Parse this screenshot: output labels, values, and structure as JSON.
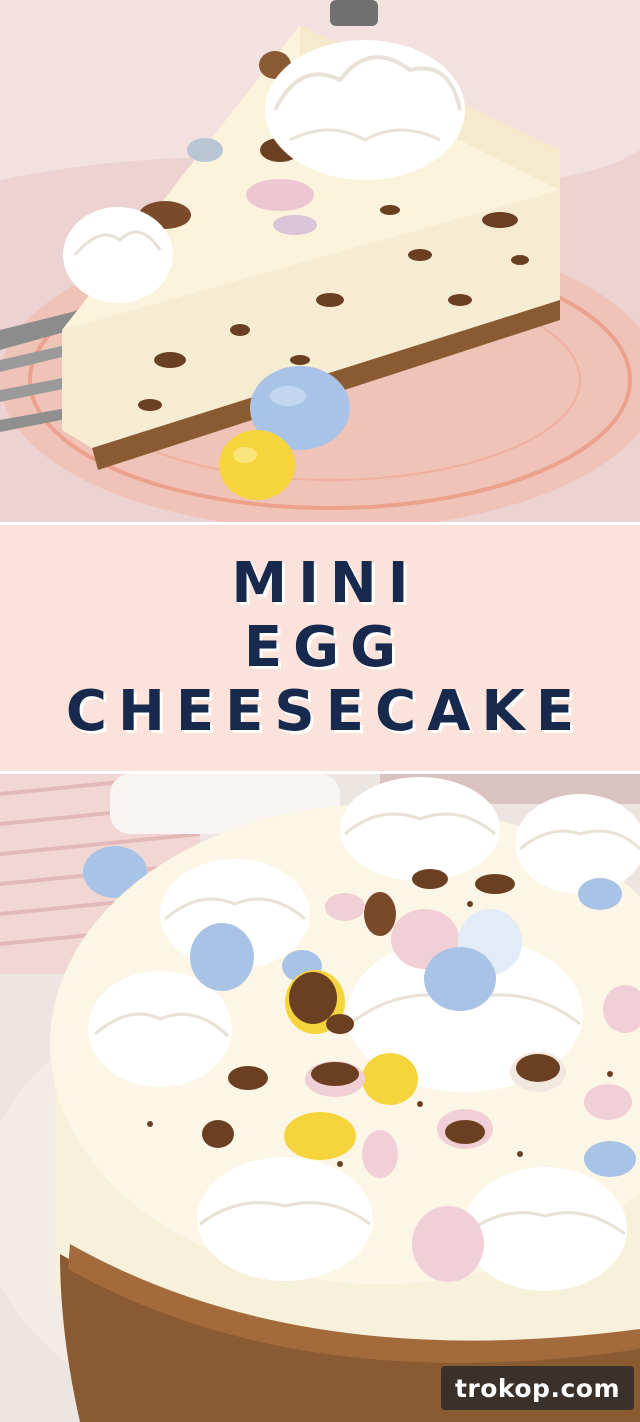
{
  "title": {
    "lines": [
      "MINI",
      "EGG",
      "CHEESECAKE"
    ],
    "text_color": "#172a4d",
    "band_color": "#fbe3dc"
  },
  "watermark": {
    "text": "trokop.com"
  },
  "photos": {
    "top": {
      "subject": "cheesecake-slice-on-pink-glass-plate-with-fork"
    },
    "bottom": {
      "subject": "whole-mini-egg-cheesecake-with-whipped-cream-swirls"
    }
  },
  "palette": {
    "egg_blue": "#a9c3e6",
    "egg_yellow": "#f5d43c",
    "egg_pink": "#f1cfd6",
    "cream": "#fbf6ea",
    "crust": "#8a5a32"
  }
}
